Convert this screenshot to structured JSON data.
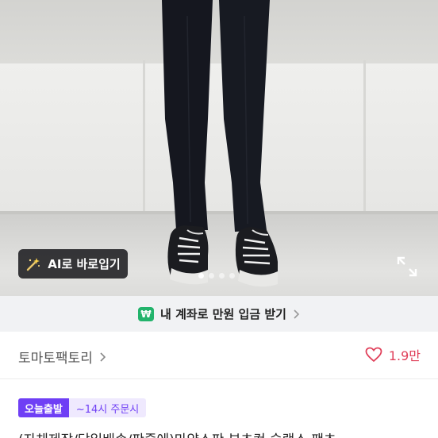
{
  "photo": {
    "ai_button_label": "AI로 바로입기",
    "ai_button_icon": "magic-wand-icon",
    "expand_icon": "expand-icon",
    "carousel": {
      "count": 4,
      "active_index": 0
    }
  },
  "promo": {
    "badge_text": "₩",
    "text": "내 계좌로 만원 입금 받기",
    "badge_color": "#22b36b"
  },
  "shop": {
    "name": "토마토팩토리",
    "like_count": "1.9만",
    "like_color": "#e0405a"
  },
  "tags": {
    "main": "오늘출발",
    "sub": "~14시 주문시",
    "accent": "#6f3ff5"
  },
  "product": {
    "title": "(자체제작/당일배송/판줄에)마약스판 부츠컷 슬랙스 팬츠"
  }
}
